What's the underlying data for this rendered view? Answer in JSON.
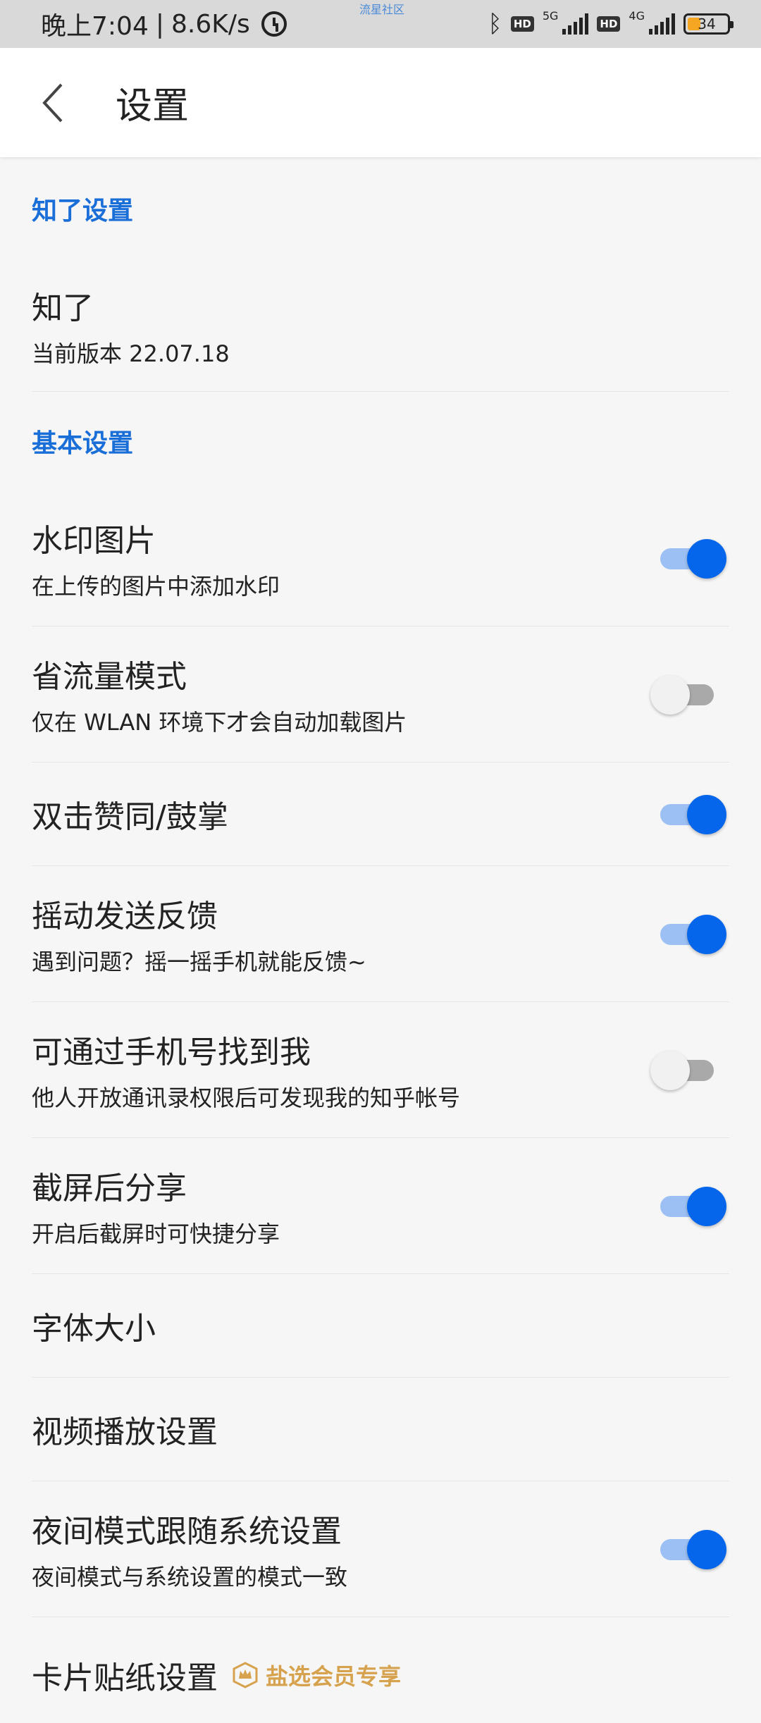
{
  "status_bar": {
    "time": "晚上7:04",
    "speed": "8.6K/s",
    "center_label": "流星社区",
    "hd1": "HD",
    "net1": "5G",
    "hd2": "HD",
    "net2": "4G",
    "battery": "34"
  },
  "header": {
    "title": "设置"
  },
  "sections": [
    {
      "title": "知了设置",
      "items": [
        {
          "title": "知了",
          "subtitle": "当前版本 22.07.18"
        }
      ]
    },
    {
      "title": "基本设置",
      "items": [
        {
          "title": "水印图片",
          "subtitle": "在上传的图片中添加水印",
          "toggle": true
        },
        {
          "title": "省流量模式",
          "subtitle": "仅在 WLAN 环境下才会自动加载图片",
          "toggle": false
        },
        {
          "title": "双击赞同/鼓掌",
          "toggle": true
        },
        {
          "title": "摇动发送反馈",
          "subtitle": "遇到问题？摇一摇手机就能反馈~",
          "toggle": true
        },
        {
          "title": "可通过手机号找到我",
          "subtitle": "他人开放通讯录权限后可发现我的知乎帐号",
          "toggle": false
        },
        {
          "title": "截屏后分享",
          "subtitle": "开启后截屏时可快捷分享",
          "toggle": true
        },
        {
          "title": "字体大小"
        },
        {
          "title": "视频播放设置"
        },
        {
          "title": "夜间模式跟随系统设置",
          "subtitle": "夜间模式与系统设置的模式一致",
          "toggle": true
        },
        {
          "title": "卡片贴纸设置",
          "badge": "盐选会员专享"
        }
      ]
    }
  ],
  "colors": {
    "accent": "#0666eb",
    "section_title": "#1a6ed8",
    "vip_gold": "#d6a24e"
  }
}
